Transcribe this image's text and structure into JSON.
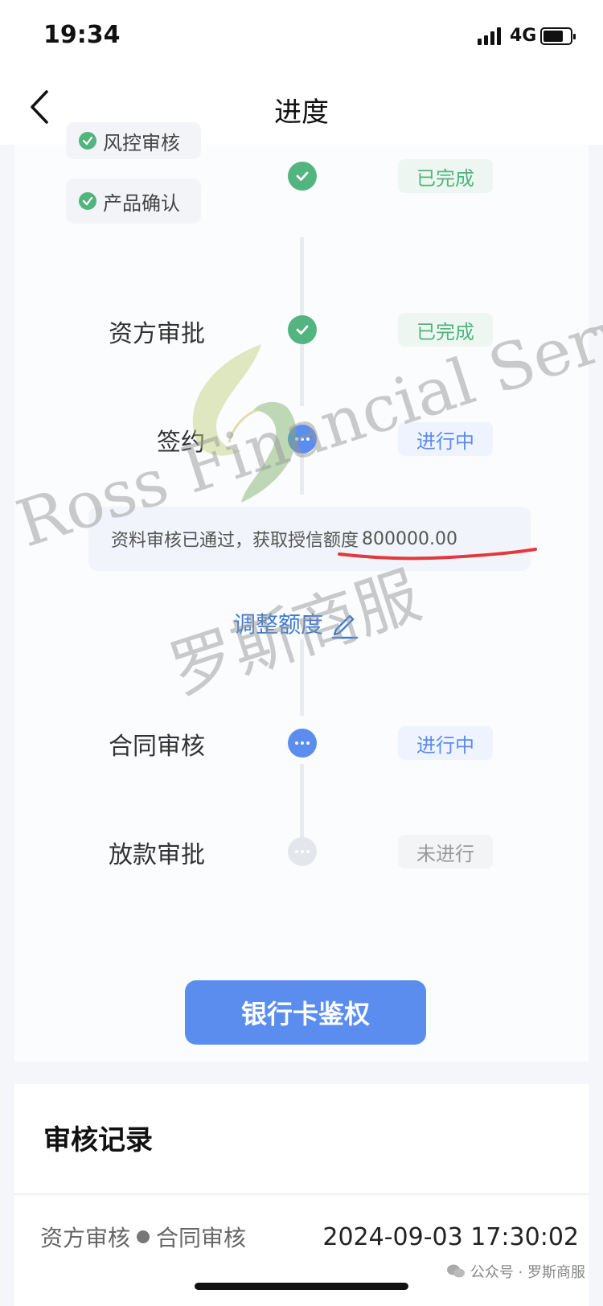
{
  "status_bar": {
    "time": "19:34",
    "network": "4G"
  },
  "nav": {
    "title": "进度"
  },
  "chips": [
    {
      "label": "风控审核"
    },
    {
      "label": "产品确认"
    }
  ],
  "steps": [
    {
      "name": "",
      "status": "已完成",
      "state": "done"
    },
    {
      "name": "资方审批",
      "status": "已完成",
      "state": "done"
    },
    {
      "name": "签约",
      "status": "进行中",
      "state": "active"
    },
    {
      "name": "合同审核",
      "status": "进行中",
      "state": "active"
    },
    {
      "name": "放款审批",
      "status": "未进行",
      "state": "idle"
    }
  ],
  "info": {
    "text": "资料审核已通过，获取授信额度",
    "amount": "800000.00"
  },
  "adjust": {
    "label": "调整额度"
  },
  "primary_button": {
    "label": "银行卡鉴权"
  },
  "records": {
    "title": "审核记录",
    "rows": [
      {
        "from": "资方审核",
        "to": "合同审核",
        "time": "2024-09-03 17:30:02"
      }
    ]
  },
  "footer": {
    "wechat": "公众号 · 罗斯商服"
  },
  "watermark": {
    "en": "Ross Financial Services",
    "cn": "罗斯商服"
  },
  "colors": {
    "done": "#52b47e",
    "active": "#5b8def",
    "idle": "#e3e6eb",
    "primary": "#5b8def",
    "highlight": "#e23a3a"
  }
}
